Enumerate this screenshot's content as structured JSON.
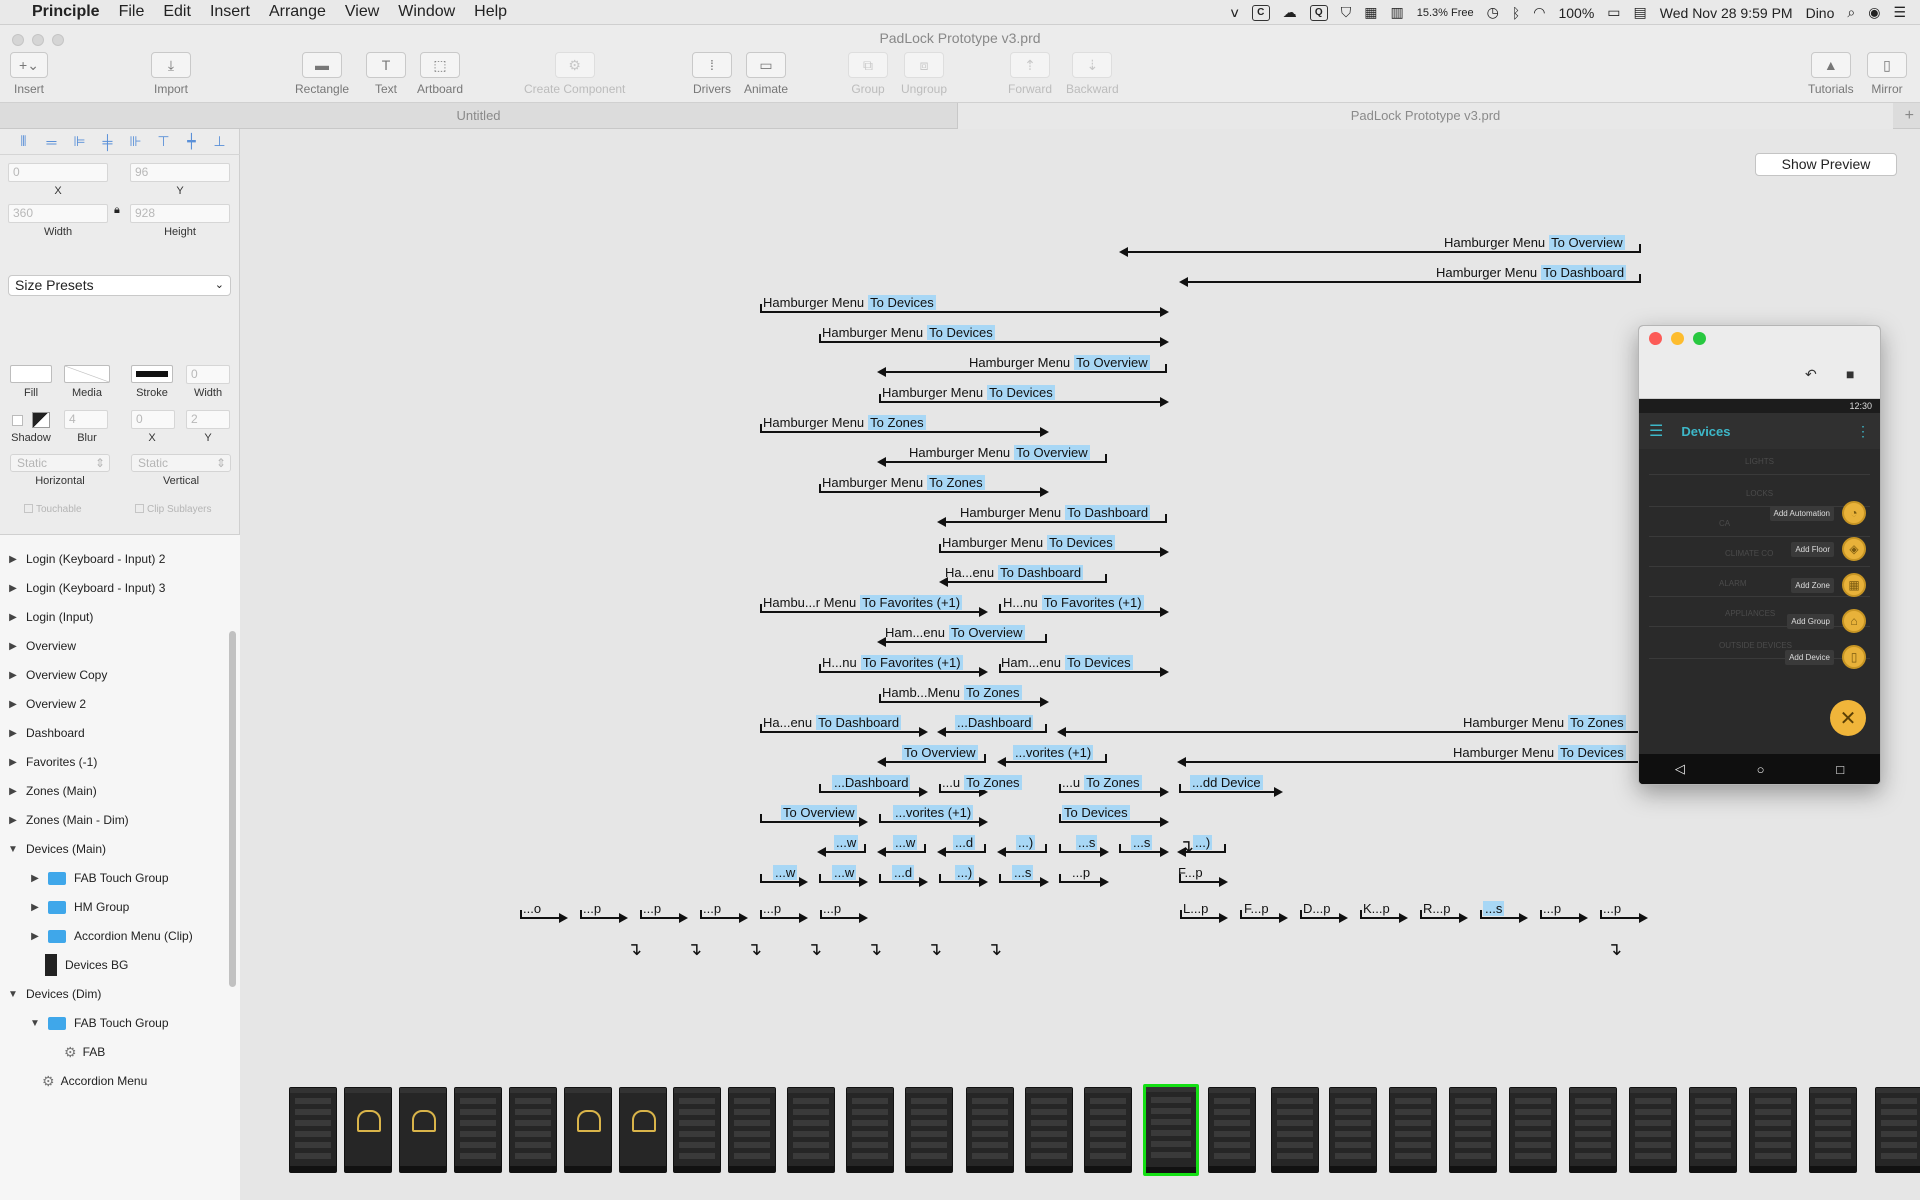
{
  "menubar": {
    "app": "Principle",
    "menus": [
      "File",
      "Edit",
      "Insert",
      "Arrange",
      "View",
      "Window",
      "Help"
    ],
    "status": {
      "memory": "15.3% Free",
      "battery": "100%",
      "datetime": "Wed Nov 28  9:59 PM",
      "user": "Dino"
    }
  },
  "window": {
    "title": "PadLock Prototype v3.prd",
    "toolbar": {
      "insert": "Insert",
      "import": "Import",
      "rectangle": "Rectangle",
      "text": "Text",
      "artboard": "Artboard",
      "create_component": "Create Component",
      "drivers": "Drivers",
      "animate": "Animate",
      "group": "Group",
      "ungroup": "Ungroup",
      "forward": "Forward",
      "backward": "Backward",
      "tutorials": "Tutorials",
      "mirror": "Mirror"
    },
    "tabs": [
      "Untitled",
      "PadLock Prototype v3.prd"
    ]
  },
  "inspector": {
    "x": "0",
    "y": "96",
    "width": "360",
    "height": "928",
    "labels": {
      "x": "X",
      "y": "Y",
      "width": "Width",
      "height": "Height",
      "fill": "Fill",
      "media": "Media",
      "stroke": "Stroke",
      "stroke_width": "Width",
      "shadow": "Shadow",
      "blur": "Blur",
      "sx": "X",
      "sy": "Y",
      "horizontal": "Horizontal",
      "vertical": "Vertical",
      "touchable": "Touchable",
      "clip": "Clip Sublayers"
    },
    "size_presets": "Size Presets",
    "stroke_width": "0",
    "shadow_blur": "4",
    "shadow_x": "0",
    "shadow_y": "2",
    "horizontal": "Static",
    "vertical": "Static"
  },
  "layers": [
    {
      "label": "Login (Keyboard - Input) 2",
      "indent": 0,
      "kind": "tri-right"
    },
    {
      "label": "Login (Keyboard - Input) 3",
      "indent": 0,
      "kind": "tri-right"
    },
    {
      "label": "Login (Input)",
      "indent": 0,
      "kind": "tri-right"
    },
    {
      "label": "Overview",
      "indent": 0,
      "kind": "tri-right"
    },
    {
      "label": "Overview Copy",
      "indent": 0,
      "kind": "tri-right"
    },
    {
      "label": "Overview 2",
      "indent": 0,
      "kind": "tri-right"
    },
    {
      "label": "Dashboard",
      "indent": 0,
      "kind": "tri-right"
    },
    {
      "label": "Favorites (-1)",
      "indent": 0,
      "kind": "tri-right"
    },
    {
      "label": "Zones (Main)",
      "indent": 0,
      "kind": "tri-right"
    },
    {
      "label": "Zones (Main - Dim)",
      "indent": 0,
      "kind": "tri-right"
    },
    {
      "label": "Devices (Main)",
      "indent": 0,
      "kind": "tri-down"
    },
    {
      "label": "FAB Touch Group",
      "indent": 1,
      "kind": "folder"
    },
    {
      "label": "HM Group",
      "indent": 1,
      "kind": "folder"
    },
    {
      "label": "Accordion Menu (Clip)",
      "indent": 1,
      "kind": "folder"
    },
    {
      "label": "Devices BG",
      "indent": 1,
      "kind": "rect"
    },
    {
      "label": "Devices (Dim)",
      "indent": 0,
      "kind": "tri-down"
    },
    {
      "label": "FAB Touch Group",
      "indent": 1,
      "kind": "folder-open"
    },
    {
      "label": "FAB",
      "indent": 2,
      "kind": "gear"
    },
    {
      "label": "Accordion Menu",
      "indent": 1,
      "kind": "gear"
    }
  ],
  "canvas": {
    "show_preview": "Show Preview",
    "connections": [
      {
        "plain": "Hamburger Menu",
        "hl": "To Overview"
      },
      {
        "plain": "Hamburger Menu",
        "hl": "To Dashboard"
      },
      {
        "plain": "Hamburger Menu",
        "hl": "To Devices"
      },
      {
        "plain": "Hamburger Menu",
        "hl": "To Devices"
      },
      {
        "plain": "Hamburger Menu",
        "hl": "To Overview"
      },
      {
        "plain": "Hamburger Menu",
        "hl": "To Devices"
      },
      {
        "plain": "Hamburger Menu",
        "hl": "To Zones"
      },
      {
        "plain": "Hamburger Menu",
        "hl": "To Overview"
      },
      {
        "plain": "Hamburger Menu",
        "hl": "To Zones"
      },
      {
        "plain": "Hamburger Menu",
        "hl": "To Dashboard"
      },
      {
        "plain": "Hamburger Menu",
        "hl": "To Devices"
      },
      {
        "plain": "Ha...enu",
        "hl": "To Dashboard"
      },
      {
        "plain": "Hambu...r Menu",
        "hl": "To Favorites (+1)"
      },
      {
        "plain": "H...nu",
        "hl": "To Favorites (+1)"
      },
      {
        "plain": "Ham...enu",
        "hl": "To Overview"
      },
      {
        "plain": "H...nu",
        "hl": "To Favorites (+1)"
      },
      {
        "plain": "Ham...enu",
        "hl": "To Devices"
      },
      {
        "plain": "Hamb...Menu",
        "hl": "To Zones"
      },
      {
        "plain": "Ha...enu",
        "hl": "To Dashboard"
      },
      {
        "plain": "",
        "hl": "...Dashboard"
      },
      {
        "plain": "Hamburger Menu",
        "hl": "To Zones"
      },
      {
        "plain": "",
        "hl": "To Overview"
      },
      {
        "plain": "",
        "hl": "...vorites (+1)"
      },
      {
        "plain": "Hamburger Menu",
        "hl": "To Devices"
      },
      {
        "plain": "",
        "hl": "...Dashboard"
      },
      {
        "plain": "...u",
        "hl": "To Zones"
      },
      {
        "plain": "...u",
        "hl": "To Zones"
      },
      {
        "plain": "",
        "hl": "...dd Device"
      },
      {
        "plain": "",
        "hl": "To Overview"
      },
      {
        "plain": "",
        "hl": "...vorites (+1)"
      },
      {
        "plain": "",
        "hl": "To Devices"
      },
      {
        "plain": "",
        "hl": "...w"
      },
      {
        "plain": "",
        "hl": "...w"
      },
      {
        "plain": "",
        "hl": "...d"
      },
      {
        "plain": "",
        "hl": "...)"
      },
      {
        "plain": "",
        "hl": "...s"
      },
      {
        "plain": "",
        "hl": "...s"
      },
      {
        "plain": "",
        "hl": "...)"
      },
      {
        "plain": "",
        "hl": "...w"
      },
      {
        "plain": "",
        "hl": "...w"
      },
      {
        "plain": "",
        "hl": "...d"
      },
      {
        "plain": "",
        "hl": "...)"
      },
      {
        "plain": "",
        "hl": "...s"
      },
      {
        "plain": "...p",
        "hl": ""
      },
      {
        "plain": "F...p",
        "hl": ""
      },
      {
        "plain": "...o",
        "hl": ""
      },
      {
        "plain": "...p",
        "hl": ""
      },
      {
        "plain": "...p",
        "hl": ""
      },
      {
        "plain": "...p",
        "hl": ""
      },
      {
        "plain": "...p",
        "hl": ""
      },
      {
        "plain": "...p",
        "hl": ""
      },
      {
        "plain": "L...p",
        "hl": ""
      },
      {
        "plain": "F...p",
        "hl": ""
      },
      {
        "plain": "D...p",
        "hl": ""
      },
      {
        "plain": "K...p",
        "hl": ""
      },
      {
        "plain": "R...p",
        "hl": ""
      },
      {
        "plain": "",
        "hl": "...s"
      },
      {
        "plain": "...p",
        "hl": ""
      },
      {
        "plain": "...p",
        "hl": ""
      }
    ]
  },
  "preview": {
    "time": "12:30",
    "title": "Devices",
    "sections": [
      "LIGHTS",
      "LOCKS",
      "CA",
      "CLIMATE CO",
      "ALARM",
      "APPLIANCES",
      "OUTSIDE DEVICES"
    ],
    "fab_items": [
      "Add Automation",
      "Add Floor",
      "Add Zone",
      "Add Group",
      "Add Device"
    ],
    "fab_close": "✕"
  }
}
